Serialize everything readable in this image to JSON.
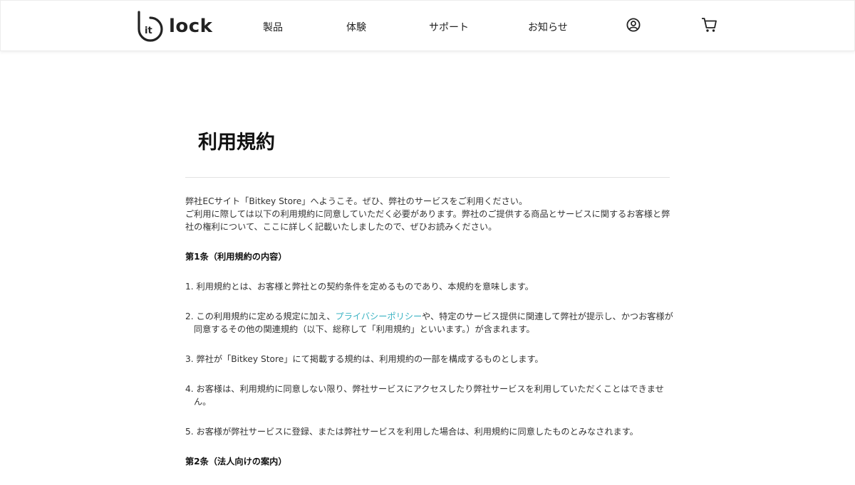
{
  "header": {
    "logo_text": "lock",
    "logo_mark": "it",
    "nav": [
      "製品",
      "体験",
      "サポート",
      "お知らせ"
    ],
    "account_icon": "user-circle-icon",
    "cart_icon": "cart-icon"
  },
  "page": {
    "title": "利用規約",
    "intro_line1": "弊社ECサイト「Bitkey Store」へようこそ。ぜひ、弊社のサービスをご利用ください。",
    "intro_line2": "ご利用に際しては以下の利用規約に同意していただく必要があります。弊社のご提供する商品とサービスに関するお客様と弊社の権利について、ここに詳しく記載いたしましたので、ぜひお読みください。",
    "article1_heading": "第1条（利用規約の内容）",
    "items": {
      "i1": "1. 利用規約とは、お客様と弊社との契約条件を定めるものであり、本規約を意味します。",
      "i2_pre": "2. この利用規約に定める規定に加え、",
      "i2_link": "プライバシーポリシー",
      "i2_post": "や、特定のサービス提供に関連して弊社が提示し、かつお客様が同意するその他の関連規約（以下、総称して「利用規約」といいます。）が含まれます。",
      "i3": "3. 弊社が「Bitkey Store」にて掲載する規約は、利用規約の一部を構成するものとします。",
      "i4": "4. お客様は、利用規約に同意しない限り、弊社サービスにアクセスしたり弊社サービスを利用していただくことはできません。",
      "i5": "5. お客様が弊社サービスに登録、または弊社サービスを利用した場合は、利用規約に同意したものとみなされます。"
    },
    "article2_heading": "第2条（法人向けの案内）"
  },
  "colors": {
    "link": "#3bb3c3",
    "text": "#333333"
  }
}
